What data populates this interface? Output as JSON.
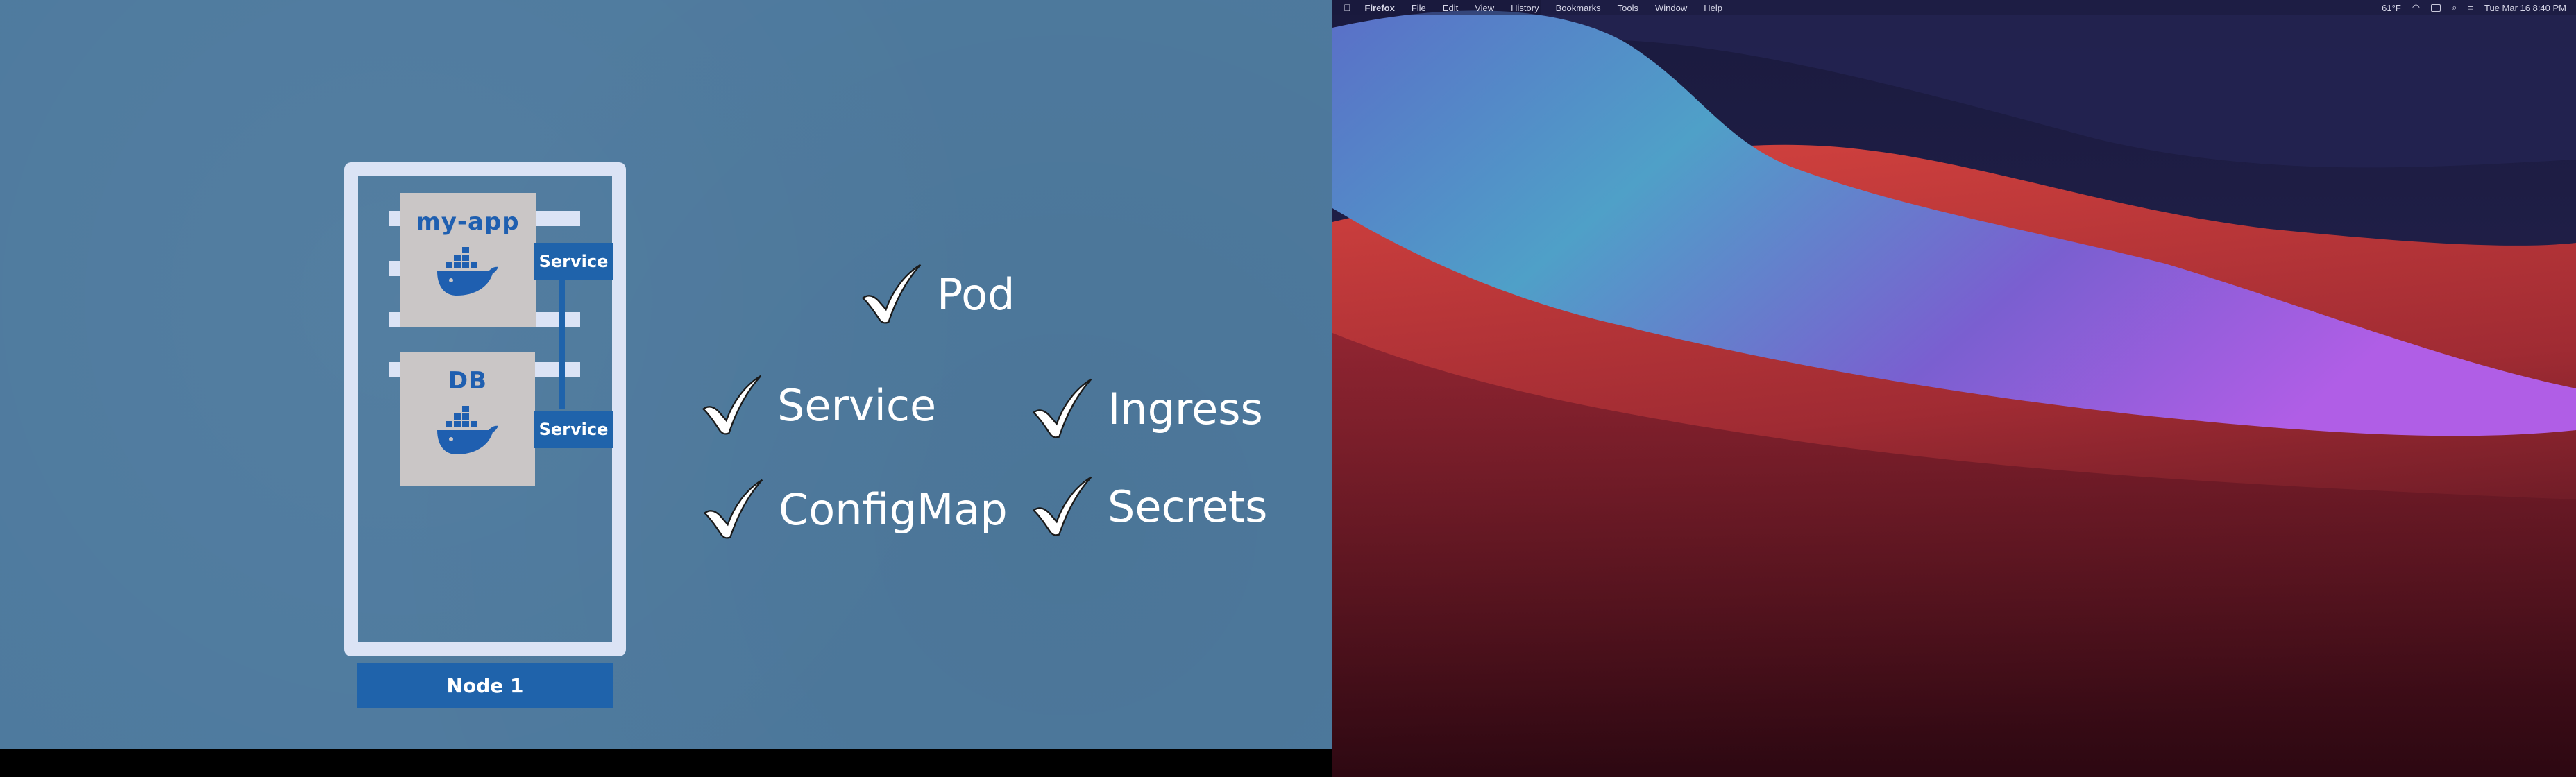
{
  "slide": {
    "node_label": "Node 1",
    "pods": [
      {
        "title": "my-app",
        "service_label": "Service"
      },
      {
        "title": "DB",
        "service_label": "Service"
      }
    ],
    "checklist": [
      {
        "label": "Pod"
      },
      {
        "label": "Service"
      },
      {
        "label": "Ingress"
      },
      {
        "label": "ConfigMap"
      },
      {
        "label": "Secrets"
      }
    ],
    "colors": {
      "background": "#4e7a9e",
      "node_frame": "#dbe3f5",
      "accent_blue": "#1f63ab",
      "pod_box": "#cac6c6",
      "text": "#ffffff"
    }
  },
  "desktop": {
    "menubar": {
      "app_name": "Firefox",
      "menus": [
        "File",
        "Edit",
        "View",
        "History",
        "Bookmarks",
        "Tools",
        "Window",
        "Help"
      ],
      "status_items": [
        "61°F",
        "Tue Mar 16  8:40 PM"
      ]
    },
    "wallpaper": "macOS Big Sur",
    "icons": [
      "apple-icon",
      "wifi-icon",
      "battery-icon",
      "search-icon",
      "control-center-icon"
    ]
  }
}
